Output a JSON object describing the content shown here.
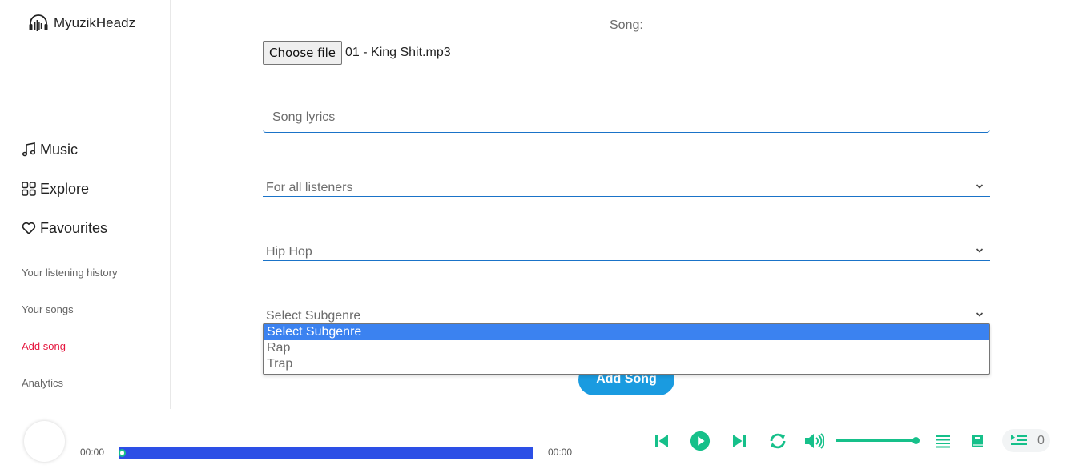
{
  "app": {
    "name": "MyuzikHeadz"
  },
  "nav": {
    "main": [
      {
        "label": "Music",
        "icon": "music-note-icon"
      },
      {
        "label": "Explore",
        "icon": "grid-icon"
      },
      {
        "label": "Favourites",
        "icon": "heart-icon"
      }
    ],
    "sub": [
      {
        "label": "Your listening history",
        "active": false
      },
      {
        "label": "Your songs",
        "active": false
      },
      {
        "label": "Add song",
        "active": true
      },
      {
        "label": "Analytics",
        "active": false
      }
    ]
  },
  "form": {
    "song_label": "Song:",
    "file_button": "Choose file",
    "file_name": "01 - King Shit.mp3",
    "lyrics_placeholder": "Song lyrics",
    "audience_value": "For all listeners",
    "genre_value": "Hip Hop",
    "subgenre_value": "Select Subgenre",
    "subgenre_options": [
      "Select Subgenre",
      "Rap",
      "Trap"
    ],
    "submit_label": "Add Song"
  },
  "player": {
    "time_current": "00:00",
    "time_total": "00:00",
    "progress_fraction": 0.0,
    "volume_fraction": 1.0,
    "queue_count": "0",
    "accent_color": "#16c08a",
    "progress_color": "#2c4fe6"
  },
  "colors": {
    "active_nav": "#e5163e",
    "button_blue": "#1a9be0",
    "selected_option": "#3b82f0"
  }
}
